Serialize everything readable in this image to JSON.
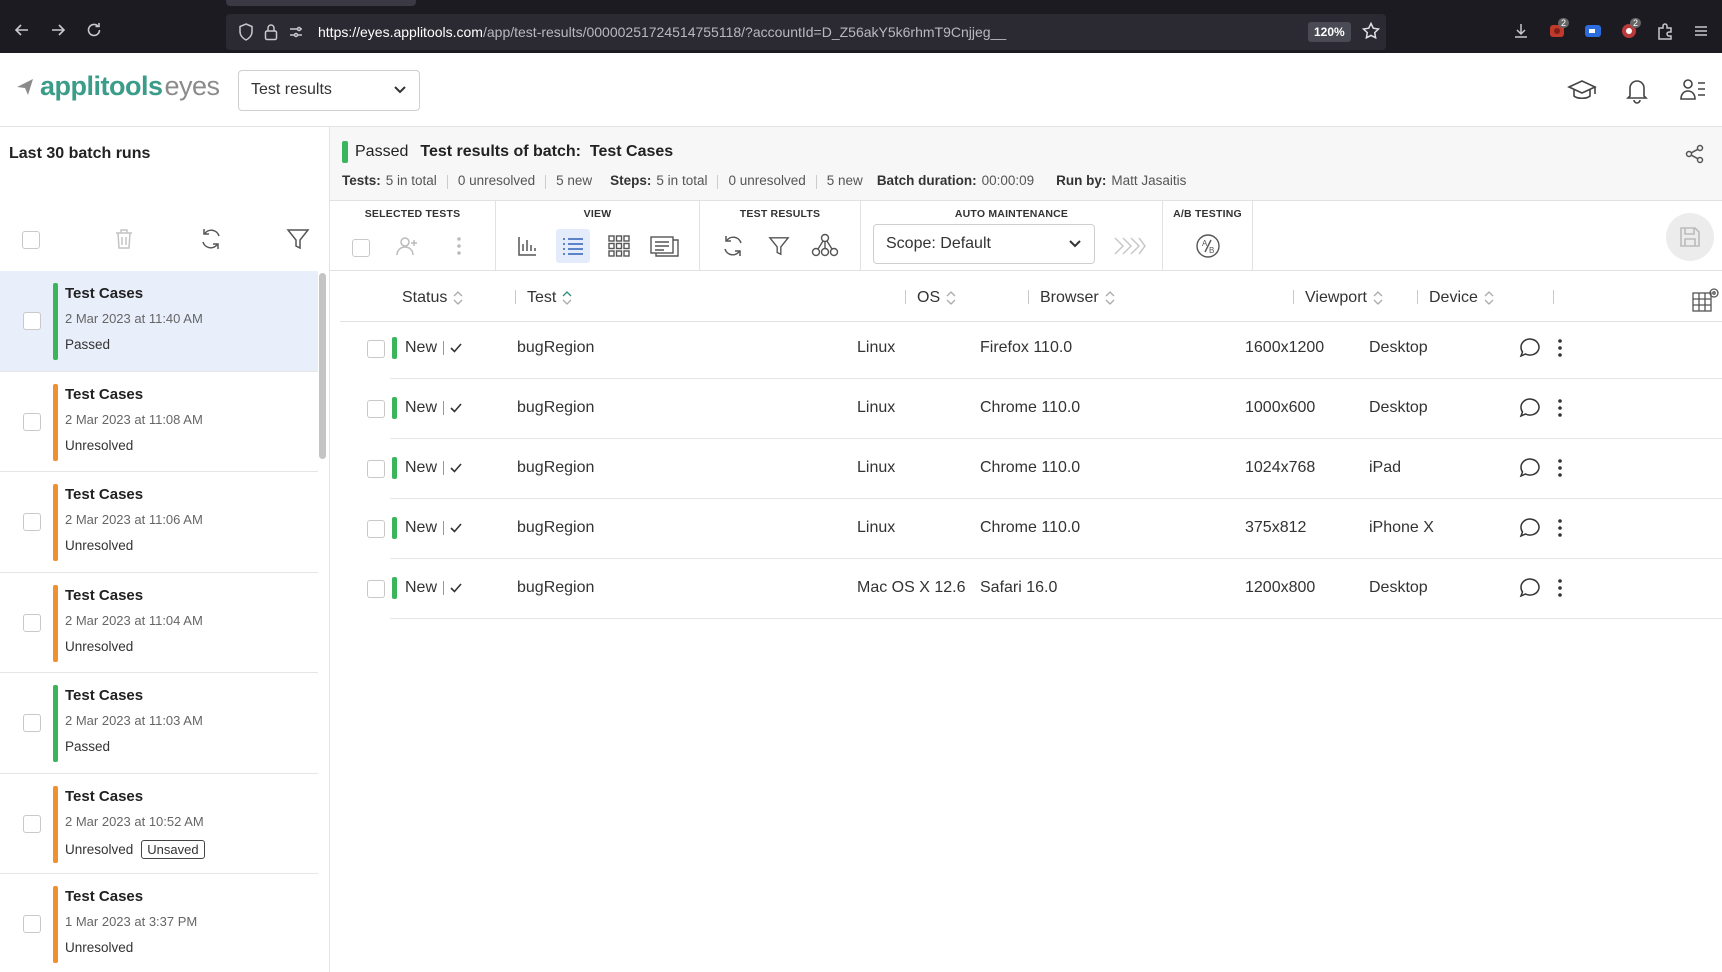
{
  "browser": {
    "url_host": "https://eyes.applitools.com",
    "url_rest": "/app/test-results/00000251724514755118/?accountId=D_Z56akY5k6rhmT9Cnjjeg__",
    "zoom": "120%",
    "badge1": "2",
    "badge2": "2"
  },
  "header": {
    "logo_main": "applitools",
    "logo_sub": "eyes",
    "selector_value": "Test results"
  },
  "sidebar": {
    "title": "Last 30 batch runs",
    "runs": [
      {
        "name": "Test Cases",
        "date": "2 Mar 2023 at 11:40 AM",
        "status": "Passed",
        "color": "#3bb55b",
        "selected": true
      },
      {
        "name": "Test Cases",
        "date": "2 Mar 2023 at 11:08 AM",
        "status": "Unresolved",
        "color": "#f0902f"
      },
      {
        "name": "Test Cases",
        "date": "2 Mar 2023 at 11:06 AM",
        "status": "Unresolved",
        "color": "#f0902f"
      },
      {
        "name": "Test Cases",
        "date": "2 Mar 2023 at 11:04 AM",
        "status": "Unresolved",
        "color": "#f0902f"
      },
      {
        "name": "Test Cases",
        "date": "2 Mar 2023 at 11:03 AM",
        "status": "Passed",
        "color": "#3bb55b"
      },
      {
        "name": "Test Cases",
        "date": "2 Mar 2023 at 10:52 AM",
        "status": "Unresolved",
        "color": "#f0902f",
        "tag": "Unsaved"
      },
      {
        "name": "Test Cases",
        "date": "1 Mar 2023 at 3:37 PM",
        "status": "Unresolved",
        "color": "#f0902f"
      }
    ]
  },
  "batch": {
    "status": "Passed",
    "title": "Test results of batch:  Test Cases",
    "tests_label": "Tests:",
    "tests_total": "5 in total",
    "tests_unresolved": "0 unresolved",
    "tests_new": "5 new",
    "steps_label": "Steps:",
    "steps_total": "5 in total",
    "steps_unresolved": "0 unresolved",
    "steps_new": "5 new",
    "duration_label": "Batch duration:",
    "duration": "00:00:09",
    "runby_label": "Run by:",
    "runby": "Matt Jasaitis"
  },
  "toolbar": {
    "selected_tests": "SELECTED TESTS",
    "view": "VIEW",
    "test_results": "TEST RESULTS",
    "auto_maintenance": "AUTO MAINTENANCE",
    "ab_testing": "A/B TESTING",
    "scope": "Scope: Default"
  },
  "table": {
    "columns": {
      "status": "Status",
      "test": "Test",
      "os": "OS",
      "browser": "Browser",
      "viewport": "Viewport",
      "device": "Device"
    },
    "rows": [
      {
        "status": "New",
        "test": "bugRegion",
        "os": "Linux",
        "browser": "Firefox 110.0",
        "viewport": "1600x1200",
        "device": "Desktop"
      },
      {
        "status": "New",
        "test": "bugRegion",
        "os": "Linux",
        "browser": "Chrome 110.0",
        "viewport": "1000x600",
        "device": "Desktop"
      },
      {
        "status": "New",
        "test": "bugRegion",
        "os": "Linux",
        "browser": "Chrome 110.0",
        "viewport": "1024x768",
        "device": "iPad"
      },
      {
        "status": "New",
        "test": "bugRegion",
        "os": "Linux",
        "browser": "Chrome 110.0",
        "viewport": "375x812",
        "device": "iPhone X"
      },
      {
        "status": "New",
        "test": "bugRegion",
        "os": "Mac OS X 12.6",
        "browser": "Safari 16.0",
        "viewport": "1200x800",
        "device": "Desktop"
      }
    ]
  },
  "colors": {
    "passed": "#3bb55b",
    "unresolved": "#f0902f",
    "brand": "#3c9c8a"
  }
}
